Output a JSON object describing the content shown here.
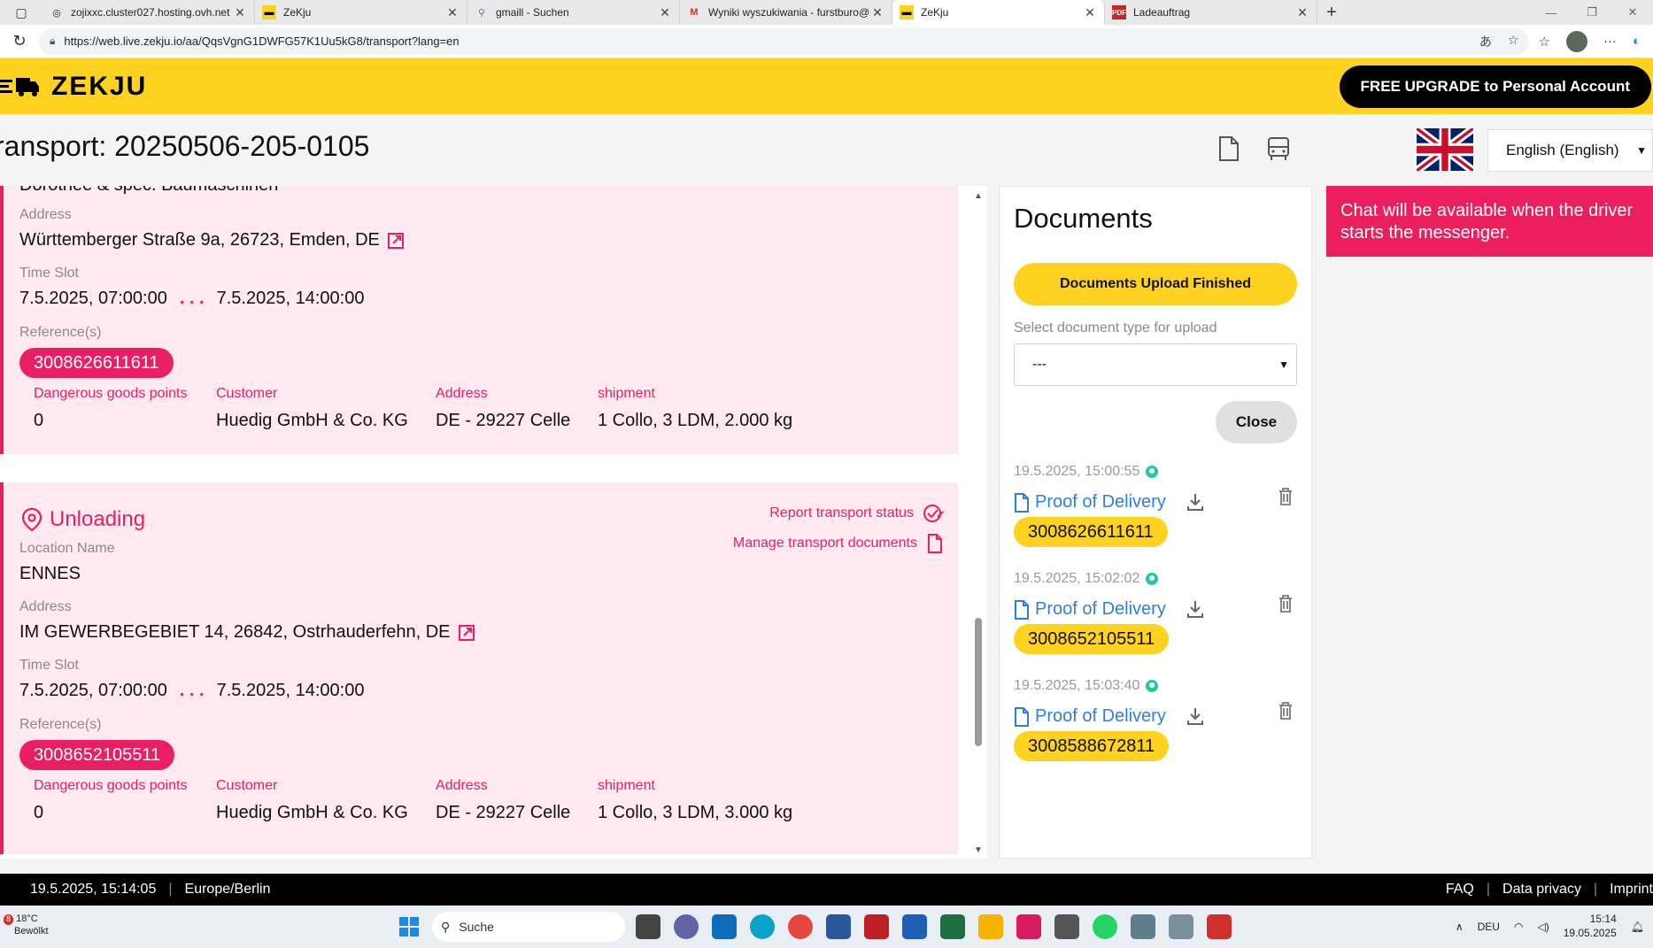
{
  "browser": {
    "tabs": [
      {
        "title": "zojixxc.cluster027.hosting.ovh.net",
        "favicon": "globe-icon",
        "active": false
      },
      {
        "title": "ZeKju",
        "favicon": "zekju-icon",
        "active": false
      },
      {
        "title": "gmaill - Suchen",
        "favicon": "search-icon",
        "active": false
      },
      {
        "title": "Wyniki wyszukiwania - furstburo@",
        "favicon": "gmail-icon",
        "active": false
      },
      {
        "title": "ZeKju",
        "favicon": "zekju-icon",
        "active": true
      },
      {
        "title": "Ladeauftrag",
        "favicon": "pdf-icon",
        "active": false
      }
    ],
    "url": "https://web.live.zekju.io/aa/QqsVgnG1DWFG57K1Uu5kG8/transport?lang=en"
  },
  "header": {
    "logo_text": "ZEKJU",
    "upgrade_label": "FREE UPGRADE to Personal Account",
    "brand_color": "#ffd21f"
  },
  "title_row": {
    "title": "ransport: 20250506-205-0105",
    "language": "English (English)"
  },
  "loading": {
    "cut_text": "Dorothee & spec. Baumaschinen",
    "address_label": "Address",
    "address": "Württemberger Straße 9a, 26723, Emden, DE",
    "timeslot_label": "Time Slot",
    "time_from": "7.5.2025, 07:00:00",
    "time_sep": ". . .",
    "time_to": "7.5.2025, 14:00:00",
    "reference_label": "Reference(s)",
    "reference": "3008626611611",
    "grid": {
      "dg_label": "Dangerous goods points",
      "dg_value": "0",
      "customer_label": "Customer",
      "customer_value": "Huedig GmbH & Co. KG",
      "address_label": "Address",
      "address_value": "DE - 29227 Celle",
      "shipment_label": "shipment",
      "shipment_value": "1 Collo, 3 LDM, 2.000 kg"
    }
  },
  "unloading": {
    "title": "Unloading",
    "report_label": "Report transport status",
    "manage_label": "Manage transport documents",
    "location_label": "Location Name",
    "location": "ENNES",
    "address_label": "Address",
    "address": "IM GEWERBEGEBIET 14, 26842, Ostrhauderfehn, DE",
    "timeslot_label": "Time Slot",
    "time_from": "7.5.2025, 07:00:00",
    "time_sep": ". . .",
    "time_to": "7.5.2025, 14:00:00",
    "reference_label": "Reference(s)",
    "reference": "3008652105511",
    "grid": {
      "dg_label": "Dangerous goods points",
      "dg_value": "0",
      "customer_label": "Customer",
      "customer_value": "Huedig GmbH & Co. KG",
      "address_label": "Address",
      "address_value": "DE - 29227 Celle",
      "shipment_label": "shipment",
      "shipment_value": "1 Collo, 3 LDM, 3.000 kg"
    }
  },
  "documents": {
    "title": "Documents",
    "upload_finished_label": "Documents Upload Finished",
    "select_label": "Select document type for upload",
    "select_value": "---",
    "close_label": "Close",
    "entries": [
      {
        "timestamp": "19.5.2025, 15:00:55",
        "name": "Proof of Delivery",
        "reference": "3008626611611"
      },
      {
        "timestamp": "19.5.2025, 15:02:02",
        "name": "Proof of Delivery",
        "reference": "3008652105511"
      },
      {
        "timestamp": "19.5.2025, 15:03:40",
        "name": "Proof of Delivery",
        "reference": "3008588672811"
      }
    ]
  },
  "chat": {
    "notice": "Chat will be available when the driver starts the messenger."
  },
  "footer": {
    "datetime": "19.5.2025, 15:14:05",
    "timezone": "Europe/Berlin",
    "faq": "FAQ",
    "privacy": "Data privacy",
    "imprint": "Imprint"
  },
  "taskbar": {
    "weather_temp": "18°C",
    "weather_desc": "Bewölkt",
    "weather_badge": "8",
    "search_placeholder": "Suche",
    "lang": "DEU",
    "time": "15:14",
    "date": "19.05.2025"
  }
}
